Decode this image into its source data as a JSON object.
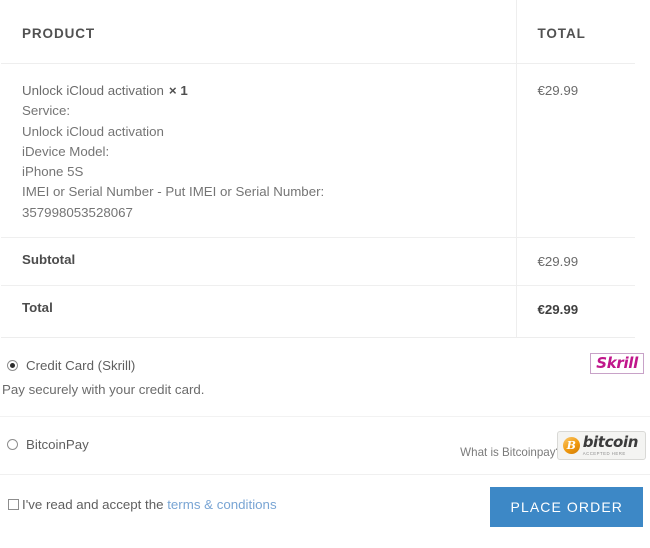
{
  "order_table": {
    "headers": {
      "product": "PRODUCT",
      "total": "TOTAL"
    },
    "items": [
      {
        "name": "Unlock iCloud activation",
        "quantity": "× 1",
        "meta": [
          "Service:",
          "Unlock iCloud activation",
          "iDevice Model:",
          "iPhone 5S",
          "IMEI or Serial Number - Put IMEI or Serial Number:",
          "357998053528067"
        ],
        "price": "€29.99"
      }
    ],
    "summary": [
      {
        "label": "Subtotal",
        "value": "€29.99"
      },
      {
        "label": "Total",
        "value": "€29.99"
      }
    ]
  },
  "payment": {
    "methods": [
      {
        "id": "credit-card-skrill",
        "label": "Credit Card (Skrill)",
        "selected": true,
        "description": "Pay securely with your credit card.",
        "badge": {
          "type": "skrill-logo",
          "text": "Skrill",
          "color": "#c0168b",
          "border_color": "#c8a2c8"
        }
      },
      {
        "id": "bitcoinpay",
        "label": "BitcoinPay",
        "selected": false,
        "help_text": "What is Bitcoinpay?",
        "badge": {
          "type": "bitcoin-logo",
          "symbol": "B",
          "name": "bitcoin",
          "tagline": "ACCEPTED HERE",
          "color": "#f3a01a"
        }
      }
    ]
  },
  "footer": {
    "terms_prefix": "I've read and accept the ",
    "terms_link": "terms & conditions",
    "terms_checked": false,
    "place_order_label": "PLACE ORDER",
    "place_order_color": "#3d88c6"
  }
}
